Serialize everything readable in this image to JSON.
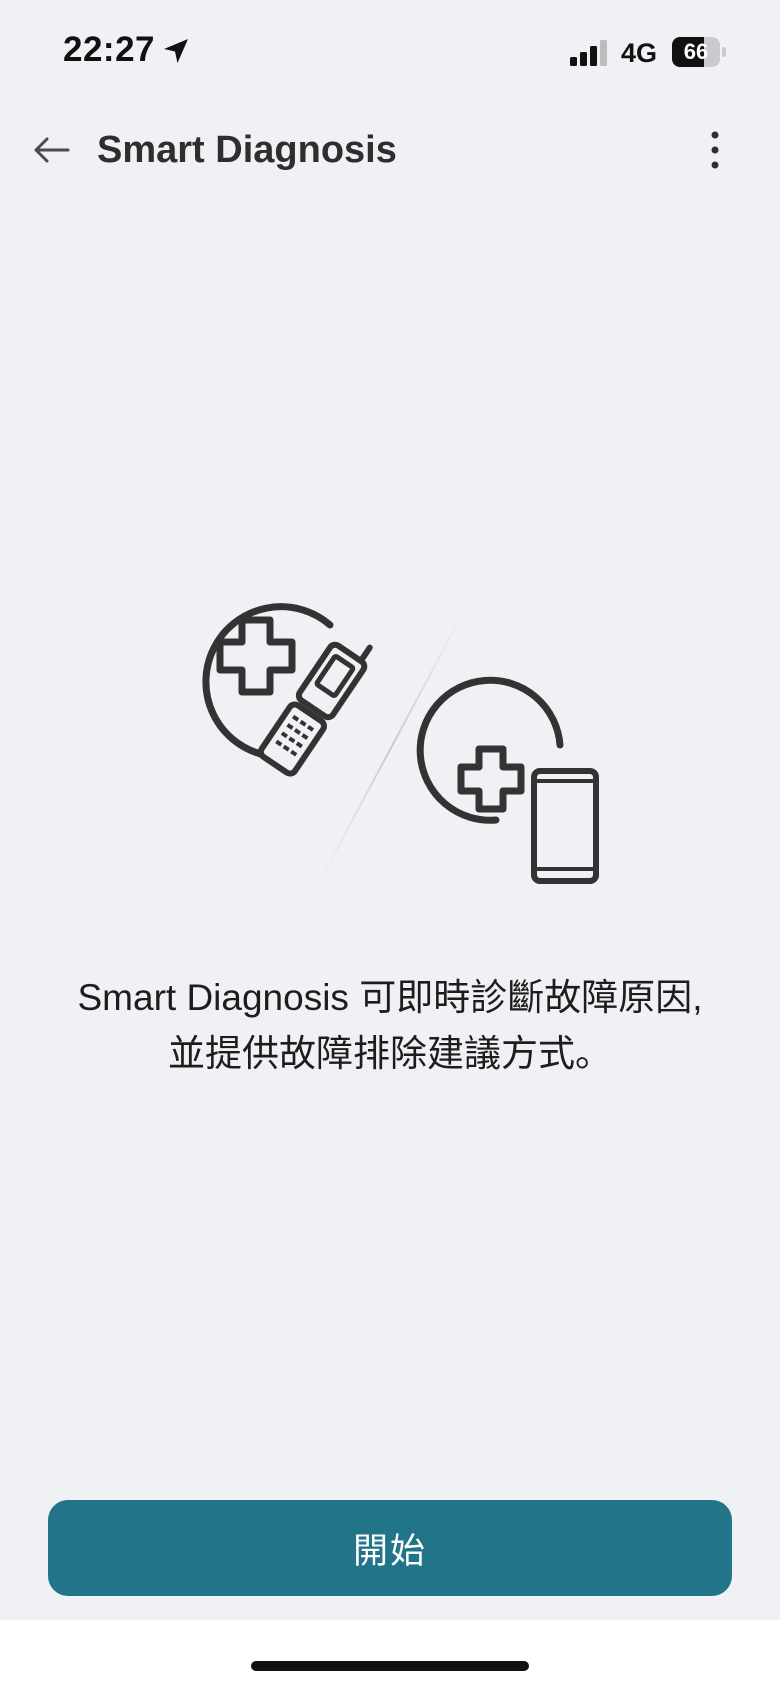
{
  "status_bar": {
    "time": "22:27",
    "network": "4G",
    "battery_level": 66,
    "battery_text": "66",
    "icons": [
      "location-arrow-icon",
      "cellular-signal-icon",
      "battery-icon"
    ]
  },
  "header": {
    "title": "Smart Diagnosis",
    "back_icon": "arrow-left-icon",
    "menu_icon": "more-vertical-icon"
  },
  "illustration": {
    "icons": [
      "medical-cross-icon",
      "flip-phone-icon",
      "smartphone-icon"
    ]
  },
  "main": {
    "description_line1": "Smart Diagnosis 可即時診斷故障原因,",
    "description_line2": "並提供故障排除建議方式。"
  },
  "footer": {
    "start_label": "開始"
  },
  "colors": {
    "background": "#eff1f4",
    "primary_button": "#227589",
    "icon_stroke": "#333333",
    "title_text": "#2e2e2e"
  }
}
